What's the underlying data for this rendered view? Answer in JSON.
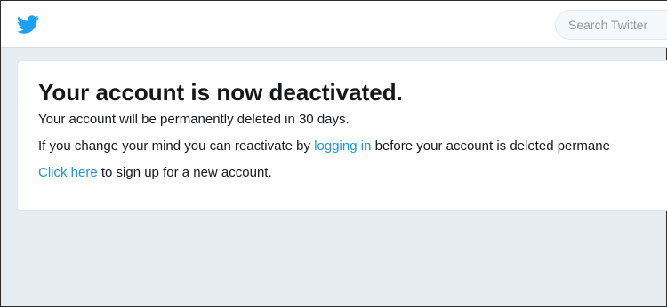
{
  "header": {
    "logo_icon": "twitter-bird-icon",
    "brand_color": "#1da1f2",
    "search": {
      "placeholder": "Search Twitter",
      "value": ""
    }
  },
  "message": {
    "title": "Your account is now deactivated.",
    "line1": "Your account will be permanently deleted in 30 days.",
    "line2": {
      "before": "If you change your mind you can reactivate by ",
      "link": "logging in",
      "after": " before your account is deleted permane"
    },
    "line3": {
      "link": "Click here",
      "after": " to sign up for a new account."
    }
  },
  "colors": {
    "link": "#1b95e0",
    "background": "#e6ecf0",
    "text": "#14171a"
  }
}
